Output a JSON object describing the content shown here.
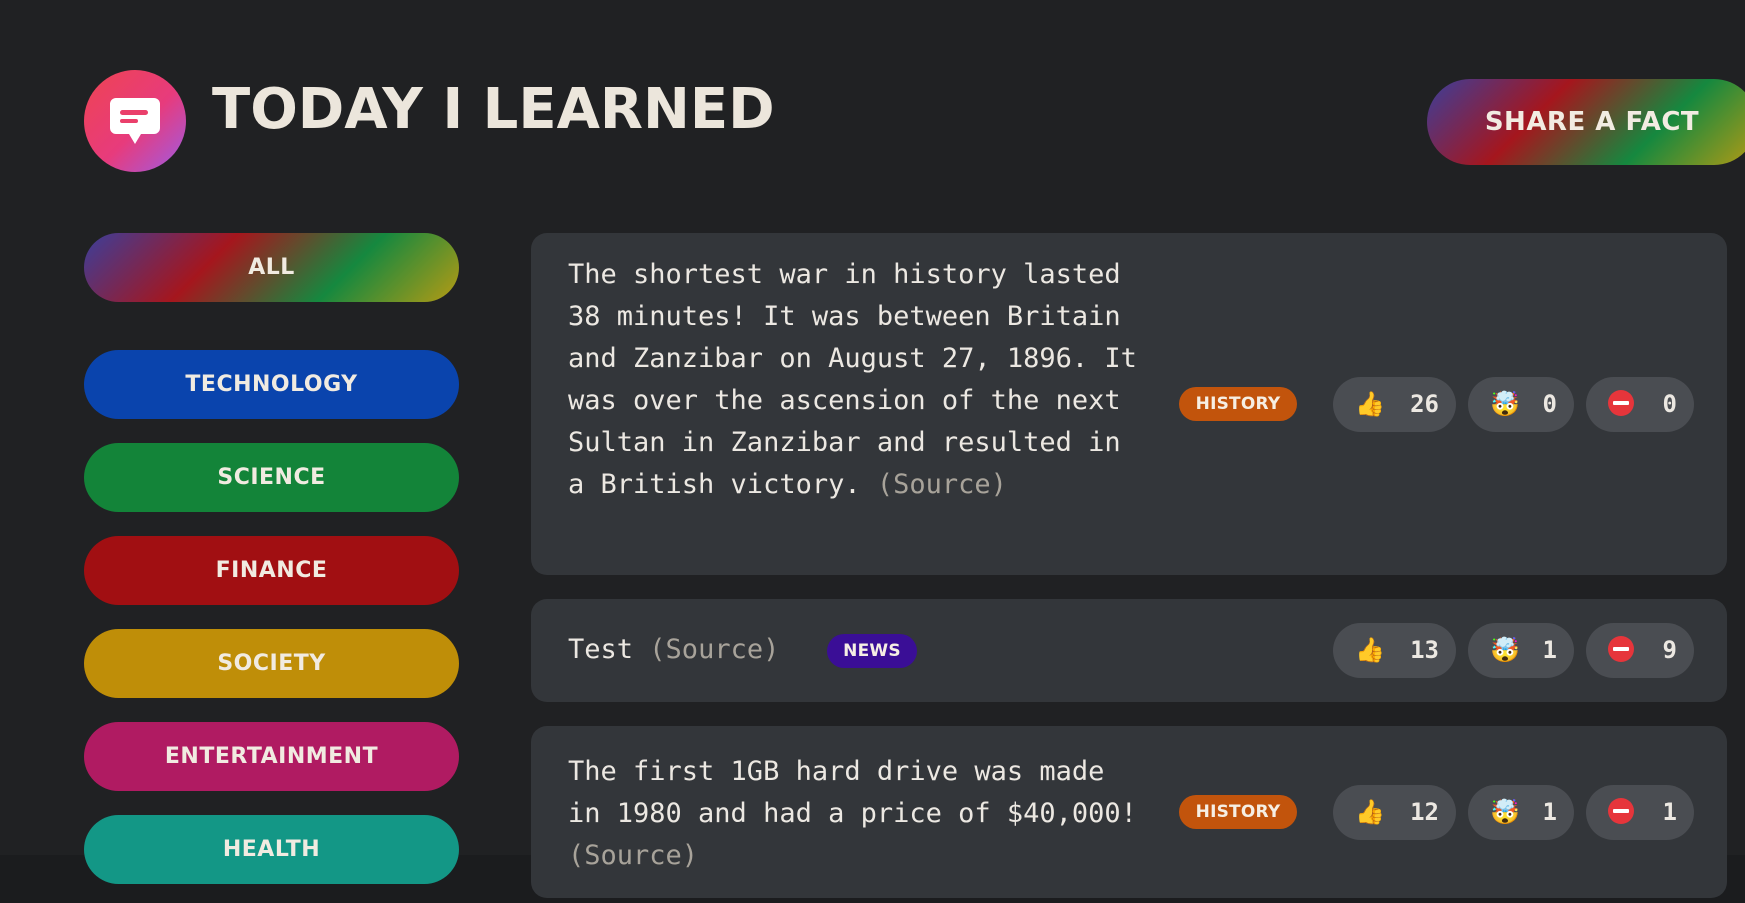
{
  "header": {
    "title": "TODAY I LEARNED",
    "share_label": "SHARE A FACT",
    "logo_icon": "chat-bubble-icon"
  },
  "categories": [
    {
      "label": "ALL",
      "color": "gradient"
    },
    {
      "label": "TECHNOLOGY",
      "color": "#0a44ad"
    },
    {
      "label": "SCIENCE",
      "color": "#138439"
    },
    {
      "label": "FINANCE",
      "color": "#a10f12"
    },
    {
      "label": "SOCIETY",
      "color": "#bf8e08"
    },
    {
      "label": "ENTERTAINMENT",
      "color": "#b01b62"
    },
    {
      "label": "HEALTH",
      "color": "#139786"
    }
  ],
  "facts": [
    {
      "text": "The shortest war in history lasted 38 minutes! It was between Britain and Zanzibar on August 27, 1896. It was over the ascension of the next Sultan in Zanzibar and resulted in a British victory.",
      "source_label": "(Source)",
      "tag": "HISTORY",
      "tag_color": "#c2540c",
      "votes": {
        "interesting": "26",
        "mindblowing": "0",
        "false": "0"
      }
    },
    {
      "text": "Test",
      "source_label": "(Source)",
      "tag": "NEWS",
      "tag_color": "#3a0e96",
      "votes": {
        "interesting": "13",
        "mindblowing": "1",
        "false": "9"
      }
    },
    {
      "text": "The first 1GB hard drive was made in 1980 and had a price of $40,000!",
      "source_label": "(Source)",
      "tag": "HISTORY",
      "tag_color": "#c2540c",
      "votes": {
        "interesting": "12",
        "mindblowing": "1",
        "false": "1"
      }
    }
  ],
  "vote_icons": {
    "interesting": "thumbs-up-icon",
    "mindblowing": "mind-blown-icon",
    "false": "no-entry-icon"
  }
}
